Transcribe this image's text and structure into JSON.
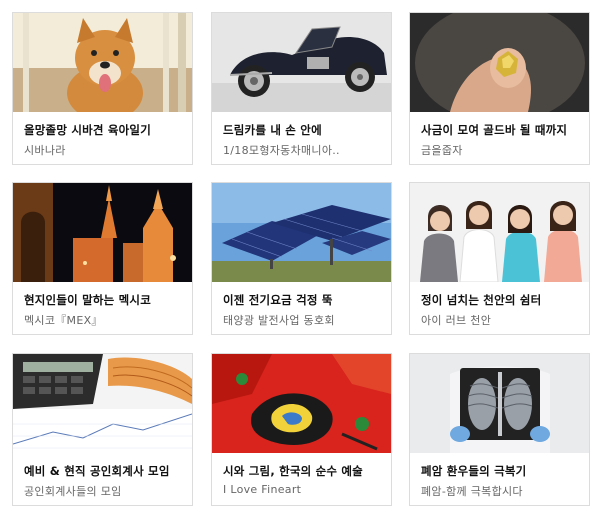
{
  "cafes": [
    {
      "title": "올망졸망 시바견 육아일기",
      "subtitle": "시바나라",
      "image": "shiba-puppy-photo"
    },
    {
      "title": "드림카를 내 손 안에",
      "subtitle": "1/18모형자동차매니아..",
      "image": "classic-model-car-photo"
    },
    {
      "title": "사금이 모여 골드바 될 때까지",
      "subtitle": "금을줍자",
      "image": "gold-nugget-photo"
    },
    {
      "title": "현지인들이 말하는 멕시코",
      "subtitle": "멕시코『MEX』",
      "image": "mexico-cathedral-night-photo"
    },
    {
      "title": "이젠 전기요금 걱정 뚝",
      "subtitle": "태양광 발전사업 동호회",
      "image": "solar-panels-photo"
    },
    {
      "title": "정이 넘치는 천안의 쉼터",
      "subtitle": "아이 러브 천안",
      "image": "smiling-women-photo"
    },
    {
      "title": "예비 & 현직 공인회계사 모임",
      "subtitle": "공인회계사들의 모임",
      "image": "calculator-banknotes-photo"
    },
    {
      "title": "시와 그림, 한국의 순수 예술",
      "subtitle": "I Love Fineart",
      "image": "abstract-painting-photo"
    },
    {
      "title": "폐암 환우들의 극복기",
      "subtitle": "폐암-함께 극복합시다",
      "image": "chest-xray-photo"
    }
  ]
}
